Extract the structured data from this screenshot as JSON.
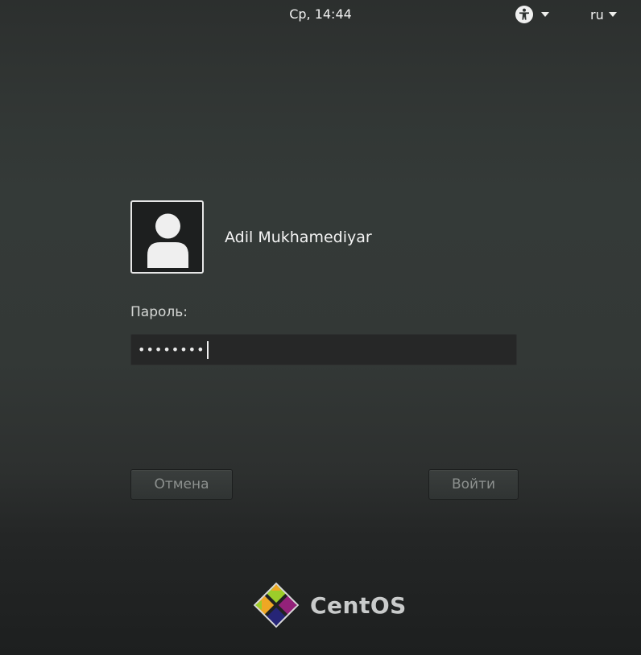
{
  "topbar": {
    "clock": "Ср, 14:44",
    "accessibility_icon": "accessibility-icon",
    "language": "ru"
  },
  "login": {
    "username": "Adil Mukhamediyar",
    "password_label": "Пароль:",
    "password_value": "••••••••",
    "cancel_label": "Отмена",
    "signin_label": "Войти"
  },
  "branding": {
    "logo_text": "CentOS"
  },
  "colors": {
    "background_top": "#323735",
    "background_bottom": "#1d1f1f",
    "text": "#eeeeec",
    "button_text": "#8c908e"
  }
}
